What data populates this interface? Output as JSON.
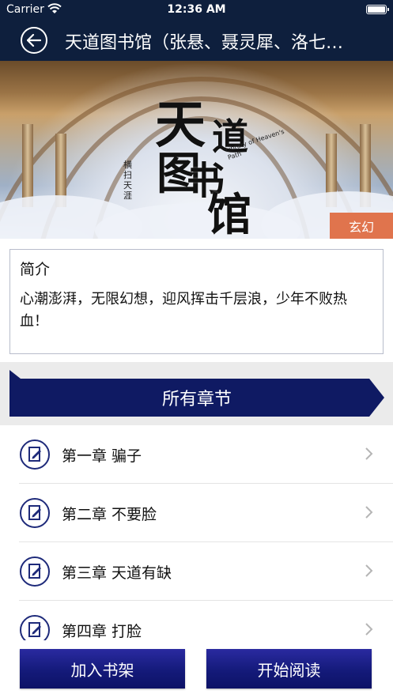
{
  "status_bar": {
    "carrier": "Carrier",
    "time": "12:36 AM"
  },
  "nav": {
    "title": "天道图书馆（张悬、聂灵犀、洛七…"
  },
  "cover": {
    "title_chars": [
      "天",
      "道",
      "图",
      "书",
      "馆"
    ],
    "subtitle": "Library of Heaven's Path",
    "author": "横扫天涯",
    "genre": "玄幻"
  },
  "intro": {
    "heading": "简介",
    "text": "心潮澎湃，无限幻想，迎风挥击千层浪，少年不败热血！"
  },
  "chapters": {
    "header": "所有章节",
    "items": [
      {
        "title": "第一章 骗子"
      },
      {
        "title": "第二章 不要脸"
      },
      {
        "title": "第三章 天道有缺"
      },
      {
        "title": "第四章 打脸"
      }
    ]
  },
  "actions": {
    "add_to_shelf": "加入书架",
    "start_reading": "开始阅读"
  },
  "colors": {
    "nav_bg": "#0e1f3d",
    "accent": "#0f1a63",
    "badge": "#e0744d"
  }
}
